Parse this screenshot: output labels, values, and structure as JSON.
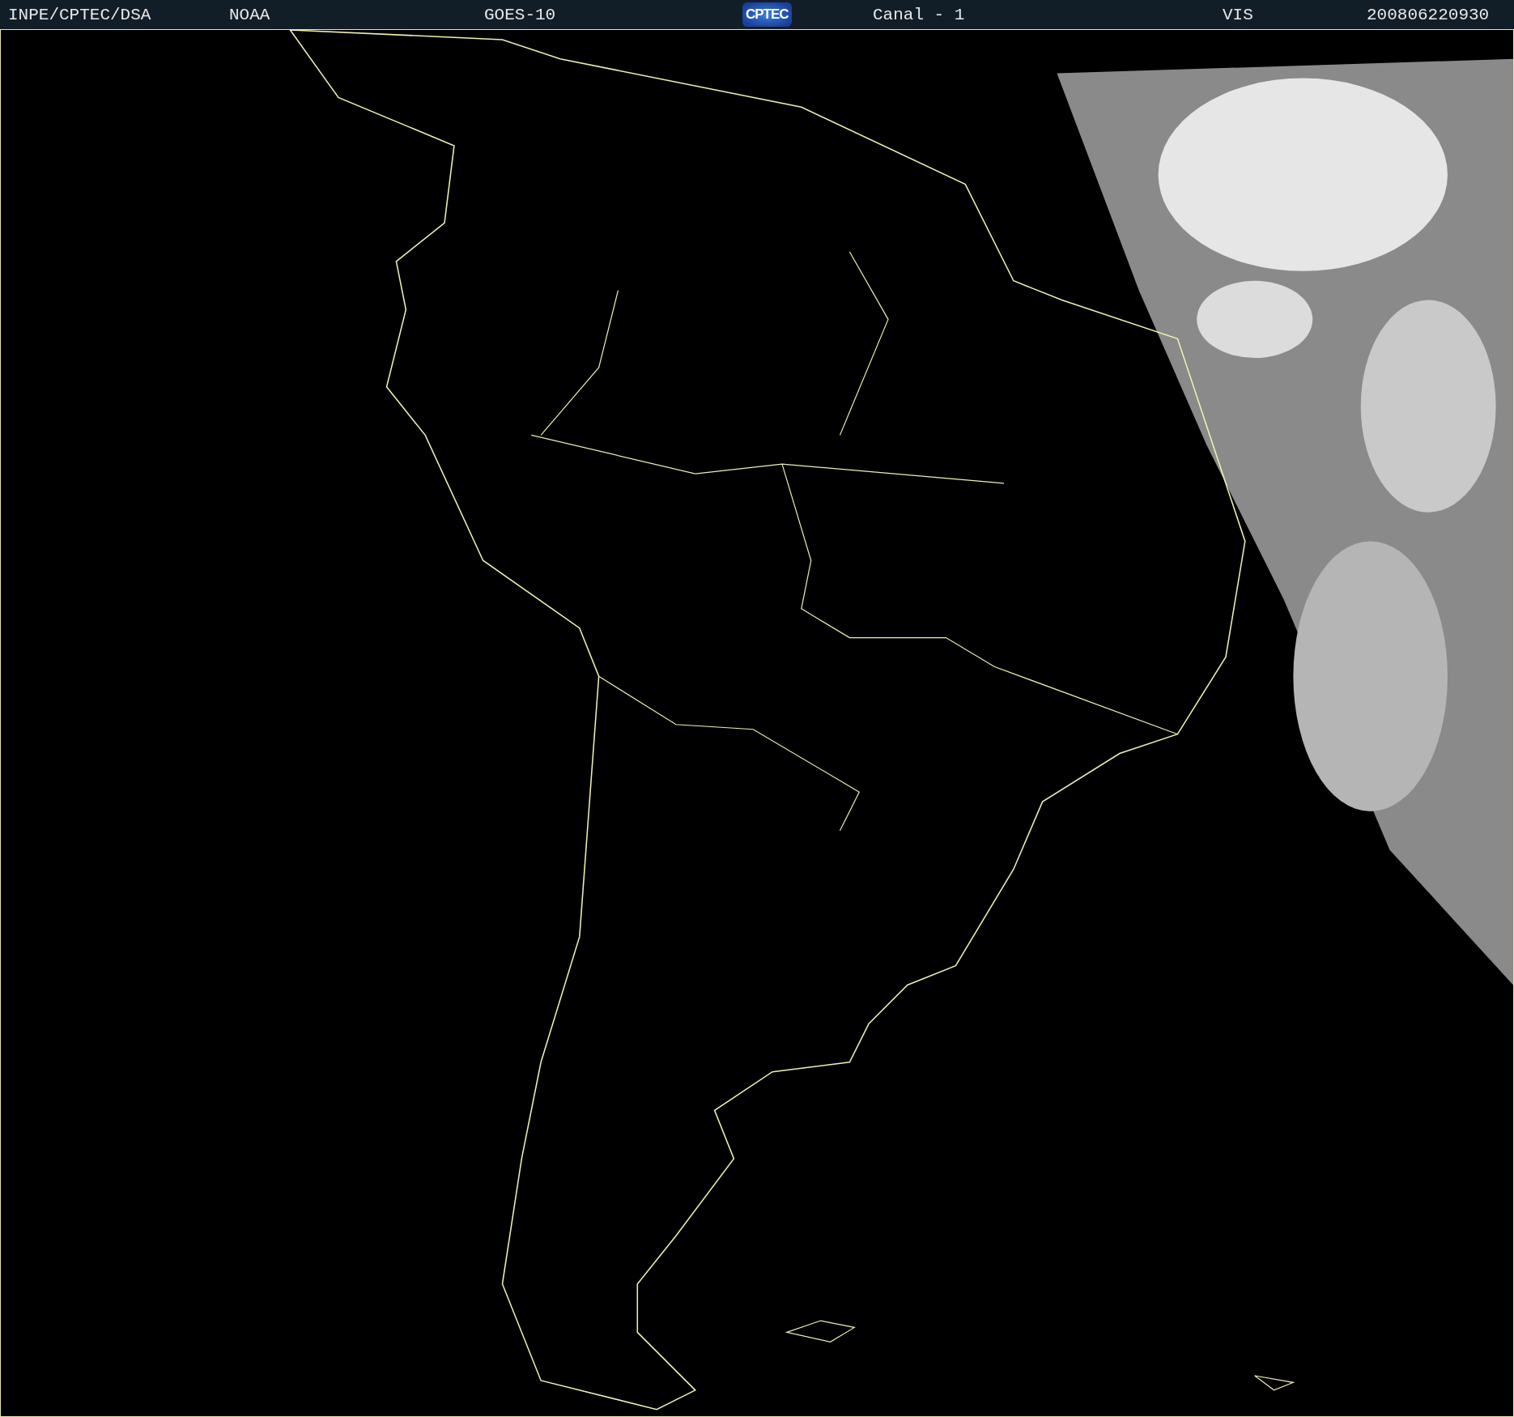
{
  "header": {
    "items": [
      {
        "kind": "text",
        "text": "INPE/CPTEC/DSA"
      },
      {
        "kind": "text",
        "text": "NOAA"
      },
      {
        "kind": "text",
        "text": "GOES-10"
      },
      {
        "kind": "logo",
        "text": "CPTEC"
      },
      {
        "kind": "text",
        "text": "Canal - 1"
      },
      {
        "kind": "text",
        "text": "VIS"
      },
      {
        "kind": "text",
        "text": "200806220930"
      }
    ]
  }
}
